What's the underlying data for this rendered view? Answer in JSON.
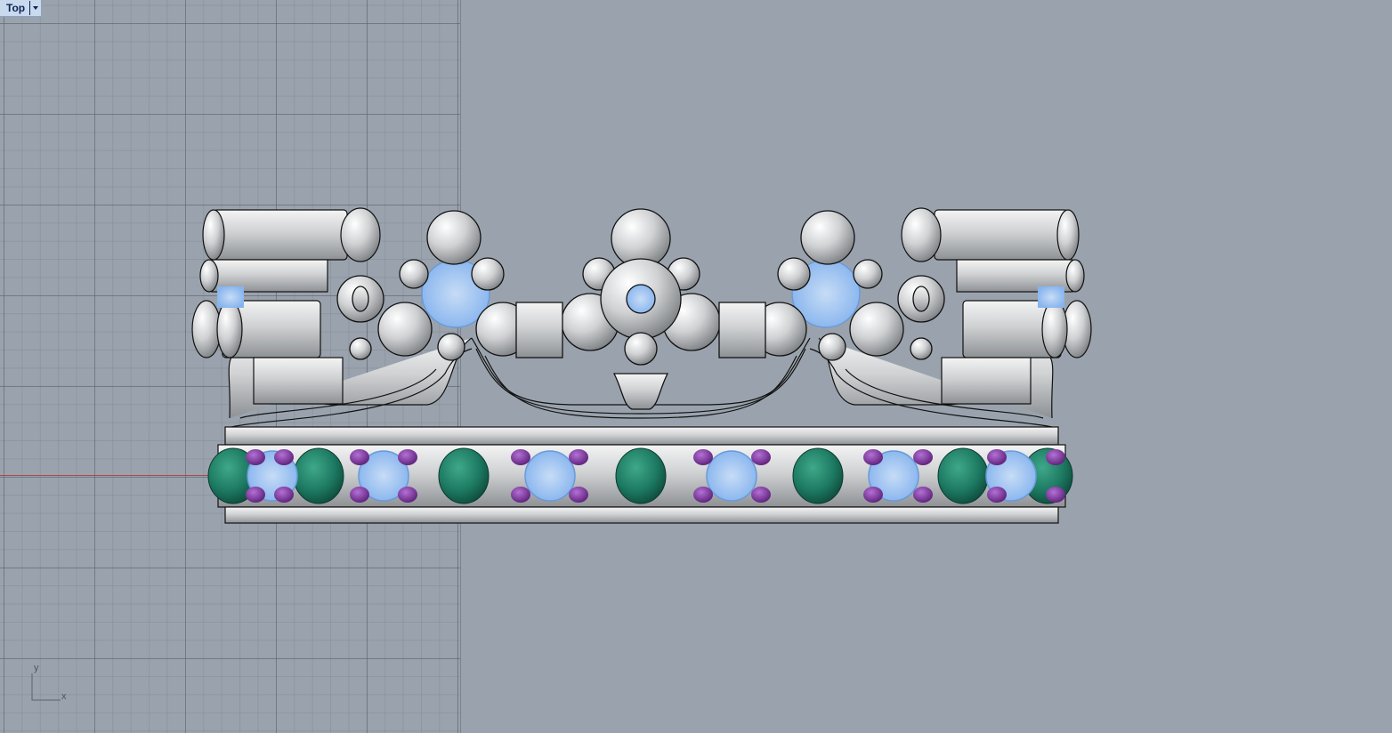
{
  "viewport": {
    "view_name": "Top",
    "axis_labels": {
      "x": "x",
      "y": "y"
    }
  },
  "colors": {
    "background": "#9aa3ad",
    "grid_line": "#5a626c",
    "x_axis": "#b9434a",
    "metal": "#d9dadb",
    "outline": "#111111",
    "emerald": "#1d7a62",
    "sapphire_light": "#9cc4f2",
    "amethyst": "#7a2c9c"
  },
  "icons": [
    "dropdown-arrow-icon",
    "axes-icon"
  ]
}
